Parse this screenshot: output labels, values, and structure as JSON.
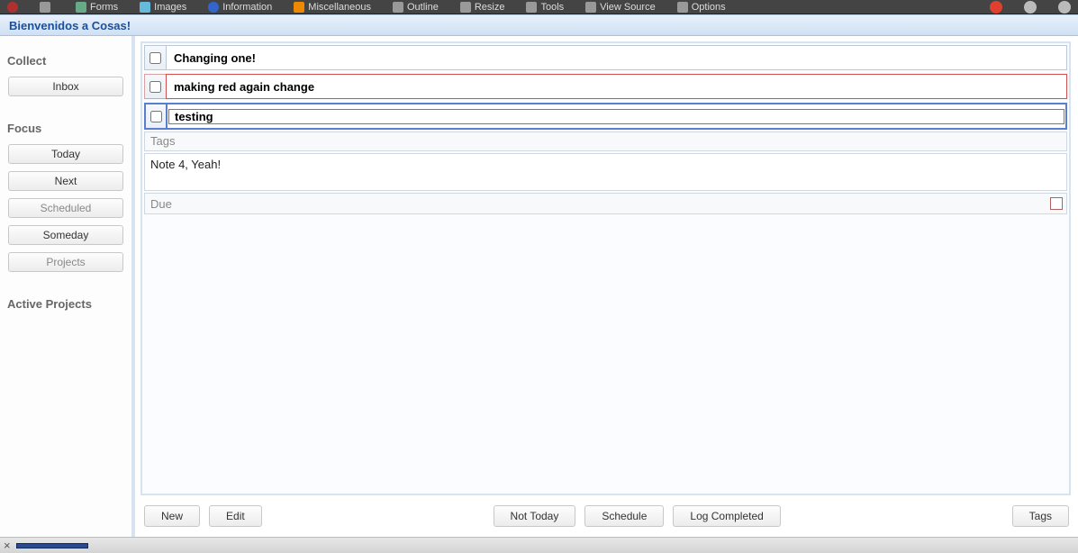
{
  "toolbar": {
    "items": [
      "Forms",
      "Images",
      "Information",
      "Miscellaneous",
      "Outline",
      "Resize",
      "Tools",
      "View Source",
      "Options"
    ]
  },
  "title_bar": {
    "text": "Bienvenidos a Cosas!"
  },
  "sidebar": {
    "collect_heading": "Collect",
    "inbox": "Inbox",
    "focus_heading": "Focus",
    "today": "Today",
    "next": "Next",
    "scheduled": "Scheduled",
    "someday": "Someday",
    "projects": "Projects",
    "active_projects_heading": "Active Projects"
  },
  "tasks": [
    {
      "text": "Changing one!",
      "checked": false,
      "variant": "normal"
    },
    {
      "text": "making red again change",
      "checked": false,
      "variant": "red"
    },
    {
      "text": "testing",
      "checked": false,
      "variant": "selected"
    }
  ],
  "detail": {
    "tags_placeholder": "Tags",
    "notes": "Note 4, Yeah!",
    "due_placeholder": "Due"
  },
  "buttons": {
    "new": "New",
    "edit": "Edit",
    "not_today": "Not Today",
    "schedule": "Schedule",
    "log_completed": "Log Completed",
    "tags": "Tags"
  },
  "status": {
    "close": "×"
  }
}
